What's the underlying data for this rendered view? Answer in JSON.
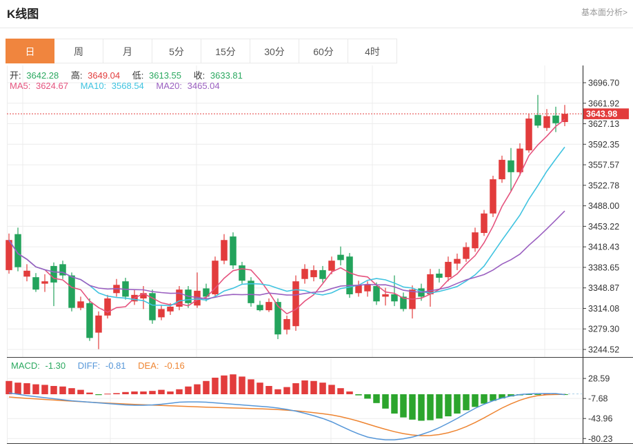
{
  "header": {
    "title": "K线图",
    "link_label": "基本面分析>"
  },
  "tabs": [
    {
      "label": "日",
      "active": true
    },
    {
      "label": "周",
      "active": false
    },
    {
      "label": "月",
      "active": false
    },
    {
      "label": "5分",
      "active": false
    },
    {
      "label": "15分",
      "active": false
    },
    {
      "label": "30分",
      "active": false
    },
    {
      "label": "60分",
      "active": false
    },
    {
      "label": "4时",
      "active": false
    }
  ],
  "quote": {
    "open_label": "开:",
    "open_value": "3642.28",
    "high_label": "高:",
    "high_value": "3649.04",
    "low_label": "低:",
    "low_value": "3613.55",
    "close_label": "收:",
    "close_value": "3633.81"
  },
  "ma": {
    "ma5_label": "MA5:",
    "ma5_value": "3624.67",
    "ma10_label": "MA10:",
    "ma10_value": "3568.54",
    "ma20_label": "MA20:",
    "ma20_value": "3465.04"
  },
  "macd_info": {
    "macd_label": "MACD:",
    "macd_value": "-1.30",
    "diff_label": "DIFF:",
    "diff_value": "-0.81",
    "dea_label": "DEA:",
    "dea_value": "-0.16"
  },
  "palette": {
    "up": "#e23c3c",
    "down": "#23a35c",
    "hist_up": "#e23c3c",
    "hist_down": "#2ca52d",
    "ma5": "#e5537e",
    "ma10": "#3fc3e0",
    "ma20": "#9a5fc0",
    "diff": "#5596d8",
    "dea": "#ee8430",
    "text_green": "#2aa85f",
    "text_red": "#e23c3c",
    "tab_active_bg": "#f0853e",
    "grid": "#ececec",
    "axis_line": "#3a3a3a",
    "axis_text": "#333333",
    "current_price_line": "#e23c3c",
    "current_price_bg": "#e23c3c",
    "macd_zero_dash": "#a9cfe8"
  },
  "chart_data": {
    "type": "candlestick",
    "title": "K线图",
    "legend": [
      "MA5",
      "MA10",
      "MA20"
    ],
    "grid": true,
    "price_axis": {
      "position": "right",
      "tick_labels": [
        "3696.70",
        "3661.92",
        "3627.13",
        "3592.35",
        "3557.57",
        "3522.78",
        "3488.00",
        "3453.22",
        "3418.43",
        "3383.65",
        "3348.87",
        "3314.08",
        "3279.30",
        "3244.52"
      ],
      "tick_values": [
        3696.7,
        3661.92,
        3627.13,
        3592.35,
        3557.57,
        3522.78,
        3488.0,
        3453.22,
        3418.43,
        3383.65,
        3348.87,
        3314.08,
        3279.3,
        3244.52
      ]
    },
    "current_price": {
      "value": 3643.98,
      "label": "3643.98"
    },
    "ma_periods": [
      5,
      10,
      20
    ],
    "candles": [
      [
        3379,
        3441,
        3373,
        3430
      ],
      [
        3440,
        3451,
        3377,
        3384
      ],
      [
        3368,
        3389,
        3360,
        3378
      ],
      [
        3367,
        3374,
        3342,
        3346
      ],
      [
        3356,
        3372,
        3342,
        3360
      ],
      [
        3386,
        3392,
        3318,
        3358
      ],
      [
        3389,
        3395,
        3364,
        3370
      ],
      [
        3370,
        3375,
        3309,
        3315
      ],
      [
        3315,
        3334,
        3311,
        3326
      ],
      [
        3323,
        3331,
        3259,
        3264
      ],
      [
        3273,
        3309,
        3245,
        3302
      ],
      [
        3302,
        3337,
        3297,
        3331
      ],
      [
        3340,
        3364,
        3334,
        3354
      ],
      [
        3360,
        3366,
        3329,
        3334
      ],
      [
        3326,
        3346,
        3320,
        3337
      ],
      [
        3331,
        3352,
        3313,
        3340
      ],
      [
        3340,
        3346,
        3288,
        3294
      ],
      [
        3299,
        3319,
        3294,
        3313
      ],
      [
        3309,
        3323,
        3303,
        3317
      ],
      [
        3317,
        3352,
        3311,
        3346
      ],
      [
        3346,
        3352,
        3315,
        3323
      ],
      [
        3319,
        3375,
        3315,
        3344
      ],
      [
        3348,
        3356,
        3326,
        3334
      ],
      [
        3338,
        3402,
        3334,
        3395
      ],
      [
        3395,
        3440,
        3389,
        3430
      ],
      [
        3436,
        3443,
        3381,
        3387
      ],
      [
        3387,
        3393,
        3356,
        3361
      ],
      [
        3361,
        3367,
        3317,
        3323
      ],
      [
        3320,
        3327,
        3309,
        3311
      ],
      [
        3311,
        3331,
        3308,
        3325
      ],
      [
        3325,
        3331,
        3262,
        3270
      ],
      [
        3278,
        3302,
        3270,
        3296
      ],
      [
        3284,
        3370,
        3276,
        3360
      ],
      [
        3364,
        3389,
        3356,
        3381
      ],
      [
        3367,
        3387,
        3360,
        3379
      ],
      [
        3379,
        3386,
        3358,
        3364
      ],
      [
        3378,
        3402,
        3372,
        3395
      ],
      [
        3405,
        3419,
        3387,
        3396
      ],
      [
        3402,
        3408,
        3332,
        3338
      ],
      [
        3340,
        3361,
        3334,
        3354
      ],
      [
        3343,
        3360,
        3334,
        3354
      ],
      [
        3352,
        3358,
        3320,
        3326
      ],
      [
        3334,
        3349,
        3319,
        3338
      ],
      [
        3338,
        3370,
        3318,
        3326
      ],
      [
        3334,
        3341,
        3309,
        3313
      ],
      [
        3313,
        3353,
        3297,
        3346
      ],
      [
        3348,
        3356,
        3327,
        3334
      ],
      [
        3338,
        3381,
        3317,
        3372
      ],
      [
        3373,
        3381,
        3358,
        3366
      ],
      [
        3367,
        3402,
        3360,
        3393
      ],
      [
        3390,
        3407,
        3379,
        3398
      ],
      [
        3398,
        3426,
        3393,
        3418
      ],
      [
        3416,
        3451,
        3410,
        3443
      ],
      [
        3442,
        3481,
        3437,
        3475
      ],
      [
        3475,
        3539,
        3469,
        3533
      ],
      [
        3533,
        3573,
        3527,
        3566
      ],
      [
        3565,
        3586,
        3513,
        3545
      ],
      [
        3545,
        3594,
        3539,
        3585
      ],
      [
        3582,
        3644,
        3578,
        3636
      ],
      [
        3642,
        3676,
        3620,
        3624
      ],
      [
        3620,
        3652,
        3615,
        3640
      ],
      [
        3641,
        3656,
        3613,
        3628
      ],
      [
        3630,
        3659,
        3623,
        3644
      ]
    ],
    "macd": {
      "axis_tick_labels": [
        "28.59",
        "-7.68",
        "-43.96",
        "-80.23"
      ],
      "axis_tick_values": [
        28.59,
        -7.68,
        -43.96,
        -80.23
      ],
      "values_shown": {
        "macd": -1.3,
        "diff": -0.81,
        "dea": -0.16
      },
      "hist": [
        24,
        21,
        20,
        18,
        17,
        15,
        14,
        11,
        8,
        3,
        -1.5,
        1,
        2,
        4,
        5,
        5,
        6,
        8,
        5,
        9,
        14,
        18,
        24,
        30,
        34,
        36,
        32,
        27,
        21,
        15,
        9,
        13,
        20,
        25,
        24,
        21,
        17,
        11,
        5,
        -2,
        -8,
        -16,
        -26,
        -35,
        -42,
        -46,
        -48,
        -47,
        -44,
        -40,
        -35,
        -29,
        -23,
        -17,
        -12,
        -7.5,
        -4,
        -2,
        -1,
        -0.3,
        0.5,
        0.3,
        -1.3
      ],
      "diff": [
        2.5,
        0,
        -2.5,
        -4.4,
        -6.3,
        -8.1,
        -10,
        -11.9,
        -13.1,
        -14.4,
        -15.6,
        -16.9,
        -18.1,
        -19.4,
        -20,
        -20,
        -19.4,
        -18.1,
        -16.3,
        -14.4,
        -13.8,
        -13.8,
        -14.4,
        -15.6,
        -16.9,
        -18.1,
        -19.4,
        -20.6,
        -21.9,
        -23.1,
        -25,
        -27.5,
        -30.6,
        -34.4,
        -38.8,
        -43.8,
        -50,
        -57.5,
        -65,
        -71.9,
        -77.5,
        -80.6,
        -82.5,
        -82.5,
        -80.6,
        -77.5,
        -73.1,
        -67.5,
        -60.6,
        -52.5,
        -43.8,
        -34.4,
        -25.6,
        -18.1,
        -11.9,
        -6.9,
        -3.1,
        -0.6,
        0.6,
        1.3,
        1.3,
        1.3,
        -0.8
      ],
      "dea": [
        -5,
        -6.3,
        -7.5,
        -8.5,
        -9.5,
        -10.5,
        -11.5,
        -12.5,
        -13.5,
        -14.4,
        -15.3,
        -16.1,
        -16.9,
        -17.6,
        -18.4,
        -19,
        -19.6,
        -20.3,
        -20.9,
        -21.5,
        -22.1,
        -22.8,
        -23.4,
        -23.9,
        -24.4,
        -24.9,
        -25.4,
        -25.9,
        -26.4,
        -27,
        -27.8,
        -28.8,
        -30,
        -31.5,
        -33.3,
        -35.3,
        -37.5,
        -40.6,
        -44.4,
        -48.8,
        -53.8,
        -58.8,
        -63.5,
        -67.8,
        -71.3,
        -73.8,
        -75,
        -74.8,
        -73,
        -69.8,
        -65,
        -58.8,
        -51.3,
        -42.8,
        -33.8,
        -25,
        -17.3,
        -10.8,
        -5.8,
        -2.5,
        -1,
        -0.5,
        -0.16
      ]
    }
  }
}
